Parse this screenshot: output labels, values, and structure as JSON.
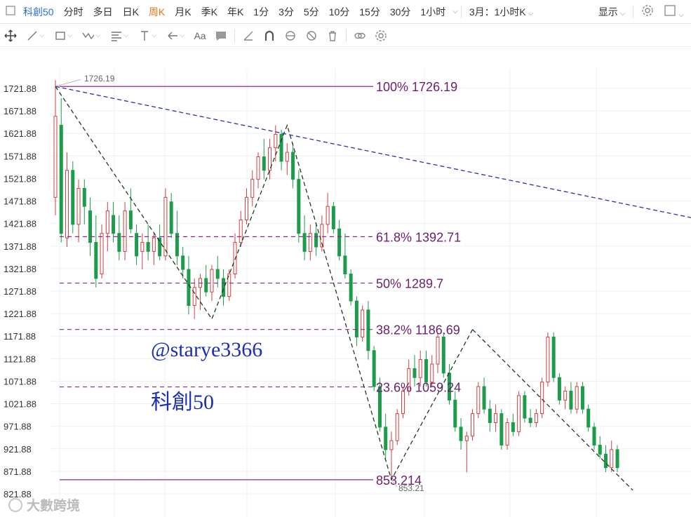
{
  "topbar": {
    "symbol": "科創50",
    "periods": [
      "分时",
      "多日",
      "日K",
      "周K",
      "月K",
      "季K",
      "年K",
      "1分",
      "3分",
      "5分",
      "10分",
      "15分",
      "30分",
      "1小时"
    ],
    "active_period": "周K",
    "combo": "3月：1小时K",
    "display": "显示"
  },
  "toolbar": {
    "icons": [
      "move-icon",
      "line-icon",
      "rect-icon",
      "wave-icon",
      "fib-icon",
      "vertical-icon",
      "arrow-icon",
      "text-icon",
      "note-icon",
      "ruler-icon",
      "magnet-icon",
      "eye-icon",
      "hide-icon",
      "trash-icon",
      "link-icon",
      "settings-icon"
    ],
    "text_tool_label": "Aa"
  },
  "chart_data": {
    "type": "candlestick",
    "ylim": [
      821.88,
      1746.19
    ],
    "yticks": [
      "1721.88",
      "1671.88",
      "1621.88",
      "1571.88",
      "1521.88",
      "1471.88",
      "1421.88",
      "1371.88",
      "1321.88",
      "1271.88",
      "1221.88",
      "1171.88",
      "1121.88",
      "1071.88",
      "1021.88",
      "971.88",
      "921.88",
      "871.88",
      "821.88"
    ],
    "colors": {
      "up": "#d23f3f",
      "down": "#1d9c4a",
      "fib": "#8a2a8a",
      "trend": "#2b2fb0",
      "zigzag": "#1f3a1f"
    },
    "fib_levels": [
      {
        "label": "100% 1726.19",
        "value": 1726.19,
        "style": "solid"
      },
      {
        "label": "61.8% 1392.71",
        "value": 1392.71,
        "style": "dashed"
      },
      {
        "label": "50% 1289.7",
        "value": 1289.7,
        "style": "dashed"
      },
      {
        "label": "38.2% 1186.69",
        "value": 1186.69,
        "style": "dashed"
      },
      {
        "label": "23.6% 1059.24",
        "value": 1059.24,
        "style": "dashed"
      },
      {
        "label": "853.214",
        "value": 853.214,
        "style": "solid"
      }
    ],
    "high_marker": "1726.19",
    "low_marker": "853.21",
    "zigzag": [
      1726.19,
      1210,
      1640,
      853.21,
      1186.69
    ],
    "trendlines": [
      {
        "name": "upper",
        "from": 1726.19,
        "to": 1435,
        "style": "dashed"
      },
      {
        "name": "lower",
        "from": 1186.69,
        "to": 830,
        "style": "dashed"
      }
    ],
    "candles": [
      {
        "o": 1480,
        "h": 1740,
        "l": 1440,
        "c": 1660
      },
      {
        "o": 1640,
        "h": 1700,
        "l": 1380,
        "c": 1400
      },
      {
        "o": 1390,
        "h": 1580,
        "l": 1370,
        "c": 1540
      },
      {
        "o": 1540,
        "h": 1560,
        "l": 1400,
        "c": 1420
      },
      {
        "o": 1420,
        "h": 1520,
        "l": 1380,
        "c": 1500
      },
      {
        "o": 1500,
        "h": 1520,
        "l": 1420,
        "c": 1460
      },
      {
        "o": 1450,
        "h": 1480,
        "l": 1350,
        "c": 1380
      },
      {
        "o": 1380,
        "h": 1440,
        "l": 1280,
        "c": 1300
      },
      {
        "o": 1310,
        "h": 1420,
        "l": 1300,
        "c": 1400
      },
      {
        "o": 1400,
        "h": 1470,
        "l": 1360,
        "c": 1450
      },
      {
        "o": 1440,
        "h": 1470,
        "l": 1380,
        "c": 1400
      },
      {
        "o": 1400,
        "h": 1440,
        "l": 1340,
        "c": 1360
      },
      {
        "o": 1360,
        "h": 1470,
        "l": 1340,
        "c": 1450
      },
      {
        "o": 1450,
        "h": 1500,
        "l": 1400,
        "c": 1410
      },
      {
        "o": 1400,
        "h": 1420,
        "l": 1330,
        "c": 1350
      },
      {
        "o": 1360,
        "h": 1400,
        "l": 1320,
        "c": 1380
      },
      {
        "o": 1380,
        "h": 1420,
        "l": 1340,
        "c": 1360
      },
      {
        "o": 1360,
        "h": 1400,
        "l": 1330,
        "c": 1390
      },
      {
        "o": 1390,
        "h": 1420,
        "l": 1340,
        "c": 1350
      },
      {
        "o": 1350,
        "h": 1500,
        "l": 1340,
        "c": 1480
      },
      {
        "o": 1470,
        "h": 1490,
        "l": 1390,
        "c": 1400
      },
      {
        "o": 1400,
        "h": 1450,
        "l": 1330,
        "c": 1350
      },
      {
        "o": 1350,
        "h": 1370,
        "l": 1300,
        "c": 1320
      },
      {
        "o": 1320,
        "h": 1350,
        "l": 1220,
        "c": 1240
      },
      {
        "o": 1240,
        "h": 1300,
        "l": 1210,
        "c": 1280
      },
      {
        "o": 1280,
        "h": 1310,
        "l": 1230,
        "c": 1300
      },
      {
        "o": 1300,
        "h": 1330,
        "l": 1260,
        "c": 1270
      },
      {
        "o": 1270,
        "h": 1330,
        "l": 1250,
        "c": 1320
      },
      {
        "o": 1320,
        "h": 1350,
        "l": 1280,
        "c": 1300
      },
      {
        "o": 1300,
        "h": 1320,
        "l": 1240,
        "c": 1260
      },
      {
        "o": 1260,
        "h": 1320,
        "l": 1250,
        "c": 1310
      },
      {
        "o": 1310,
        "h": 1400,
        "l": 1300,
        "c": 1380
      },
      {
        "o": 1380,
        "h": 1450,
        "l": 1370,
        "c": 1430
      },
      {
        "o": 1430,
        "h": 1500,
        "l": 1420,
        "c": 1480
      },
      {
        "o": 1480,
        "h": 1540,
        "l": 1460,
        "c": 1520
      },
      {
        "o": 1520,
        "h": 1580,
        "l": 1500,
        "c": 1570
      },
      {
        "o": 1570,
        "h": 1610,
        "l": 1520,
        "c": 1540
      },
      {
        "o": 1540,
        "h": 1610,
        "l": 1520,
        "c": 1590
      },
      {
        "o": 1590,
        "h": 1640,
        "l": 1560,
        "c": 1620
      },
      {
        "o": 1620,
        "h": 1630,
        "l": 1540,
        "c": 1560
      },
      {
        "o": 1560,
        "h": 1600,
        "l": 1530,
        "c": 1580
      },
      {
        "o": 1580,
        "h": 1600,
        "l": 1500,
        "c": 1520
      },
      {
        "o": 1520,
        "h": 1540,
        "l": 1380,
        "c": 1400
      },
      {
        "o": 1400,
        "h": 1440,
        "l": 1340,
        "c": 1360
      },
      {
        "o": 1360,
        "h": 1420,
        "l": 1340,
        "c": 1400
      },
      {
        "o": 1400,
        "h": 1420,
        "l": 1350,
        "c": 1370
      },
      {
        "o": 1370,
        "h": 1440,
        "l": 1360,
        "c": 1420
      },
      {
        "o": 1420,
        "h": 1490,
        "l": 1400,
        "c": 1460
      },
      {
        "o": 1460,
        "h": 1470,
        "l": 1400,
        "c": 1410
      },
      {
        "o": 1410,
        "h": 1430,
        "l": 1340,
        "c": 1350
      },
      {
        "o": 1350,
        "h": 1400,
        "l": 1300,
        "c": 1310
      },
      {
        "o": 1310,
        "h": 1320,
        "l": 1240,
        "c": 1250
      },
      {
        "o": 1250,
        "h": 1260,
        "l": 1150,
        "c": 1170
      },
      {
        "o": 1170,
        "h": 1240,
        "l": 1160,
        "c": 1230
      },
      {
        "o": 1230,
        "h": 1250,
        "l": 1120,
        "c": 1140
      },
      {
        "o": 1140,
        "h": 1150,
        "l": 1050,
        "c": 1060
      },
      {
        "o": 1060,
        "h": 1080,
        "l": 960,
        "c": 970
      },
      {
        "o": 970,
        "h": 1000,
        "l": 900,
        "c": 920
      },
      {
        "o": 920,
        "h": 960,
        "l": 860,
        "c": 940
      },
      {
        "o": 940,
        "h": 1010,
        "l": 930,
        "c": 1000
      },
      {
        "o": 1000,
        "h": 1060,
        "l": 990,
        "c": 1050
      },
      {
        "o": 1050,
        "h": 1120,
        "l": 1040,
        "c": 1100
      },
      {
        "o": 1100,
        "h": 1130,
        "l": 1060,
        "c": 1080
      },
      {
        "o": 1080,
        "h": 1140,
        "l": 1060,
        "c": 1120
      },
      {
        "o": 1120,
        "h": 1140,
        "l": 1060,
        "c": 1070
      },
      {
        "o": 1070,
        "h": 1130,
        "l": 1060,
        "c": 1110
      },
      {
        "o": 1110,
        "h": 1180,
        "l": 1090,
        "c": 1170
      },
      {
        "o": 1170,
        "h": 1180,
        "l": 1080,
        "c": 1090
      },
      {
        "o": 1090,
        "h": 1110,
        "l": 1020,
        "c": 1030
      },
      {
        "o": 1030,
        "h": 1050,
        "l": 960,
        "c": 970
      },
      {
        "o": 970,
        "h": 990,
        "l": 920,
        "c": 940
      },
      {
        "o": 940,
        "h": 960,
        "l": 870,
        "c": 950
      },
      {
        "o": 950,
        "h": 1010,
        "l": 940,
        "c": 1000
      },
      {
        "o": 1000,
        "h": 1070,
        "l": 990,
        "c": 1060
      },
      {
        "o": 1060,
        "h": 1080,
        "l": 1000,
        "c": 1010
      },
      {
        "o": 1010,
        "h": 1030,
        "l": 960,
        "c": 980
      },
      {
        "o": 980,
        "h": 1020,
        "l": 960,
        "c": 1000
      },
      {
        "o": 1000,
        "h": 1010,
        "l": 920,
        "c": 930
      },
      {
        "o": 930,
        "h": 990,
        "l": 920,
        "c": 980
      },
      {
        "o": 980,
        "h": 1000,
        "l": 950,
        "c": 960
      },
      {
        "o": 960,
        "h": 1050,
        "l": 950,
        "c": 1040
      },
      {
        "o": 1040,
        "h": 1050,
        "l": 980,
        "c": 990
      },
      {
        "o": 990,
        "h": 1010,
        "l": 970,
        "c": 980
      },
      {
        "o": 980,
        "h": 1010,
        "l": 970,
        "c": 1000
      },
      {
        "o": 1000,
        "h": 1080,
        "l": 990,
        "c": 1070
      },
      {
        "o": 1070,
        "h": 1180,
        "l": 1060,
        "c": 1170
      },
      {
        "o": 1170,
        "h": 1180,
        "l": 1070,
        "c": 1080
      },
      {
        "o": 1080,
        "h": 1090,
        "l": 1020,
        "c": 1030
      },
      {
        "o": 1030,
        "h": 1060,
        "l": 1010,
        "c": 1050
      },
      {
        "o": 1050,
        "h": 1070,
        "l": 1000,
        "c": 1010
      },
      {
        "o": 1010,
        "h": 1070,
        "l": 1000,
        "c": 1060
      },
      {
        "o": 1060,
        "h": 1070,
        "l": 1000,
        "c": 1010
      },
      {
        "o": 1010,
        "h": 1020,
        "l": 960,
        "c": 970
      },
      {
        "o": 970,
        "h": 980,
        "l": 920,
        "c": 930
      },
      {
        "o": 930,
        "h": 950,
        "l": 900,
        "c": 910
      },
      {
        "o": 910,
        "h": 930,
        "l": 870,
        "c": 880
      },
      {
        "o": 880,
        "h": 940,
        "l": 870,
        "c": 920
      },
      {
        "o": 920,
        "h": 930,
        "l": 870,
        "c": 880
      }
    ]
  },
  "watermarks": {
    "handle": "@starye3366",
    "index": "科創50",
    "brand": "大數跨境"
  }
}
